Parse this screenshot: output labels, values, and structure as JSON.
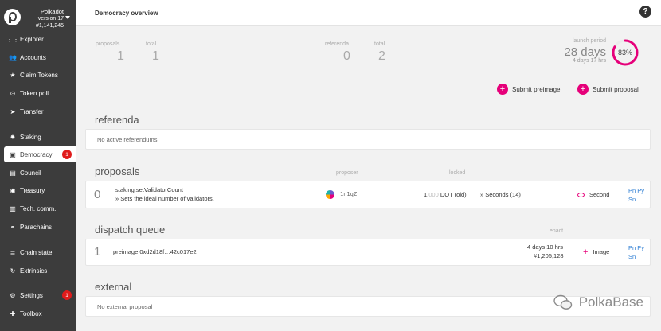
{
  "sidebar": {
    "chain_name": "Polkadot",
    "chain_version": "version 17",
    "chain_block": "#1,141,245",
    "items": [
      {
        "label": "Explorer",
        "icon": "explorer-icon",
        "glyph": "⋮⋮"
      },
      {
        "label": "Accounts",
        "icon": "accounts-icon",
        "glyph": "👥"
      },
      {
        "label": "Claim Tokens",
        "icon": "star-icon",
        "glyph": "★"
      },
      {
        "label": "Token poll",
        "icon": "poll-icon",
        "glyph": "⊙"
      },
      {
        "label": "Transfer",
        "icon": "send-icon",
        "glyph": "➤"
      },
      {
        "label": "Staking",
        "icon": "staking-icon",
        "glyph": "✸"
      },
      {
        "label": "Democracy",
        "icon": "democracy-icon",
        "glyph": "▣",
        "badge": "1"
      },
      {
        "label": "Council",
        "icon": "council-icon",
        "glyph": "▤"
      },
      {
        "label": "Treasury",
        "icon": "treasury-icon",
        "glyph": "◉"
      },
      {
        "label": "Tech. comm.",
        "icon": "tech-comm-icon",
        "glyph": "▥"
      },
      {
        "label": "Parachains",
        "icon": "parachains-icon",
        "glyph": "⚭"
      },
      {
        "label": "Chain state",
        "icon": "database-icon",
        "glyph": "≣"
      },
      {
        "label": "Extrinsics",
        "icon": "extrinsics-icon",
        "glyph": "↻"
      },
      {
        "label": "Settings",
        "icon": "settings-icon",
        "glyph": "⚙",
        "badge": "1"
      },
      {
        "label": "Toolbox",
        "icon": "toolbox-icon",
        "glyph": "✚"
      }
    ]
  },
  "header": {
    "title": "Democracy overview",
    "help": "?"
  },
  "summary": {
    "proposals_label": "proposals",
    "proposals_value": "1",
    "total_label": "total",
    "total_value": "1",
    "referenda_label": "referenda",
    "referenda_value": "0",
    "referenda_total_label": "total",
    "referenda_total_value": "2",
    "launch_label": "launch period",
    "launch_days": "28 days",
    "launch_remaining": "4 days 17 hrs",
    "launch_percent": "83%",
    "launch_fraction": 0.83,
    "accent_color": "#e6007a"
  },
  "actions": {
    "submit_preimage": "Submit preimage",
    "submit_proposal": "Submit proposal"
  },
  "referenda": {
    "title": "referenda",
    "empty": "No active referendums"
  },
  "proposals": {
    "title": "proposals",
    "col_proposer": "proposer",
    "col_locked": "locked",
    "row": {
      "index": "0",
      "call": "staking.setValidatorCount",
      "description": "» Sets the ideal number of validators.",
      "proposer": "1n1qZ",
      "locked_main": "1.",
      "locked_dim": "000",
      "locked_unit": " DOT (old)",
      "seconds": "» Seconds (14)",
      "second_button": "Second",
      "links": "Pn Py Sn"
    }
  },
  "dispatch": {
    "title": "dispatch queue",
    "col_enact": "enact",
    "row": {
      "index": "1",
      "preimage": "preimage 0xd2d18f…42c017e2",
      "enact_time": "4 days 10 hrs",
      "enact_block": "#1,205,128",
      "image_button": "Image",
      "links": "Pn Py Sn"
    }
  },
  "external": {
    "title": "external",
    "empty": "No external proposal"
  },
  "watermark": {
    "text": "PolkaBase"
  }
}
